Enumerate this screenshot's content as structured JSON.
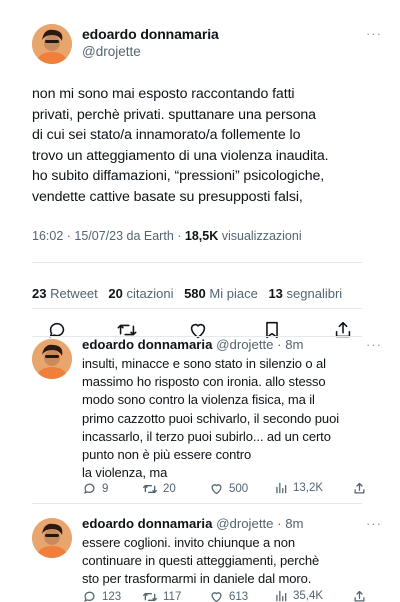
{
  "main_tweet": {
    "author_name": "edoardo donnamaria",
    "author_handle": "@drojette",
    "more_label": "···",
    "text": "non mi sono mai esposto raccontando fatti\nprivati, perchè privati. sputtanare una persona\ndi cui sei stato/a innamorato/a follemente lo\ntrovo un atteggiamento di una violenza inaudita.\nho subito diffamazioni, “pressioni” psicologiche,\nvendette cattive basate su presupposti falsi,",
    "meta": "16:02 · 15/07/23 da Earth · ",
    "views_count": "18,5K",
    "views_label": " visualizzazioni",
    "stats": {
      "retweets_count": "23",
      "retweets_label": " Retweet",
      "quotes_count": "20",
      "quotes_label": " citazioni",
      "likes_count": "580",
      "likes_label": " Mi piace",
      "bookmarks_count": "13",
      "bookmarks_label": " segnalibri"
    },
    "action_icons": [
      "reply-icon",
      "retweet-icon",
      "like-icon",
      "bookmark-icon",
      "share-icon"
    ]
  },
  "replies": [
    {
      "author_name": "edoardo donnamaria",
      "author_handle": "@drojette",
      "time": " · 8m",
      "more_label": "···",
      "text": "insulti, minacce e sono stato in silenzio o al\nmassimo ho risposto con ironia. allo stesso\nmodo sono contro la violenza fisica, ma il\nprimo cazzotto puoi schivarlo, il secondo puoi\nincassarlo, il terzo puoi subirlo... ad un certo\npunto non è più essere contro\nla violenza, ma",
      "replies_count": "9",
      "retweets_count": "20",
      "likes_count": "500",
      "views_count": "13,2K"
    },
    {
      "author_name": "edoardo donnamaria",
      "author_handle": "@drojette",
      "time": " · 8m",
      "more_label": "···",
      "text": "essere coglioni. invito chiunque a non\ncontinuare in questi atteggiamenti, perchè\nsto per trasformarmi in daniele dal moro.",
      "replies_count": "123",
      "retweets_count": "117",
      "likes_count": "613",
      "views_count": "35,4K"
    }
  ],
  "colors": {
    "text": "#0f1419",
    "secondary": "#536471",
    "divider": "#e6e9ec",
    "avatar_bg": "#f3b27a"
  }
}
